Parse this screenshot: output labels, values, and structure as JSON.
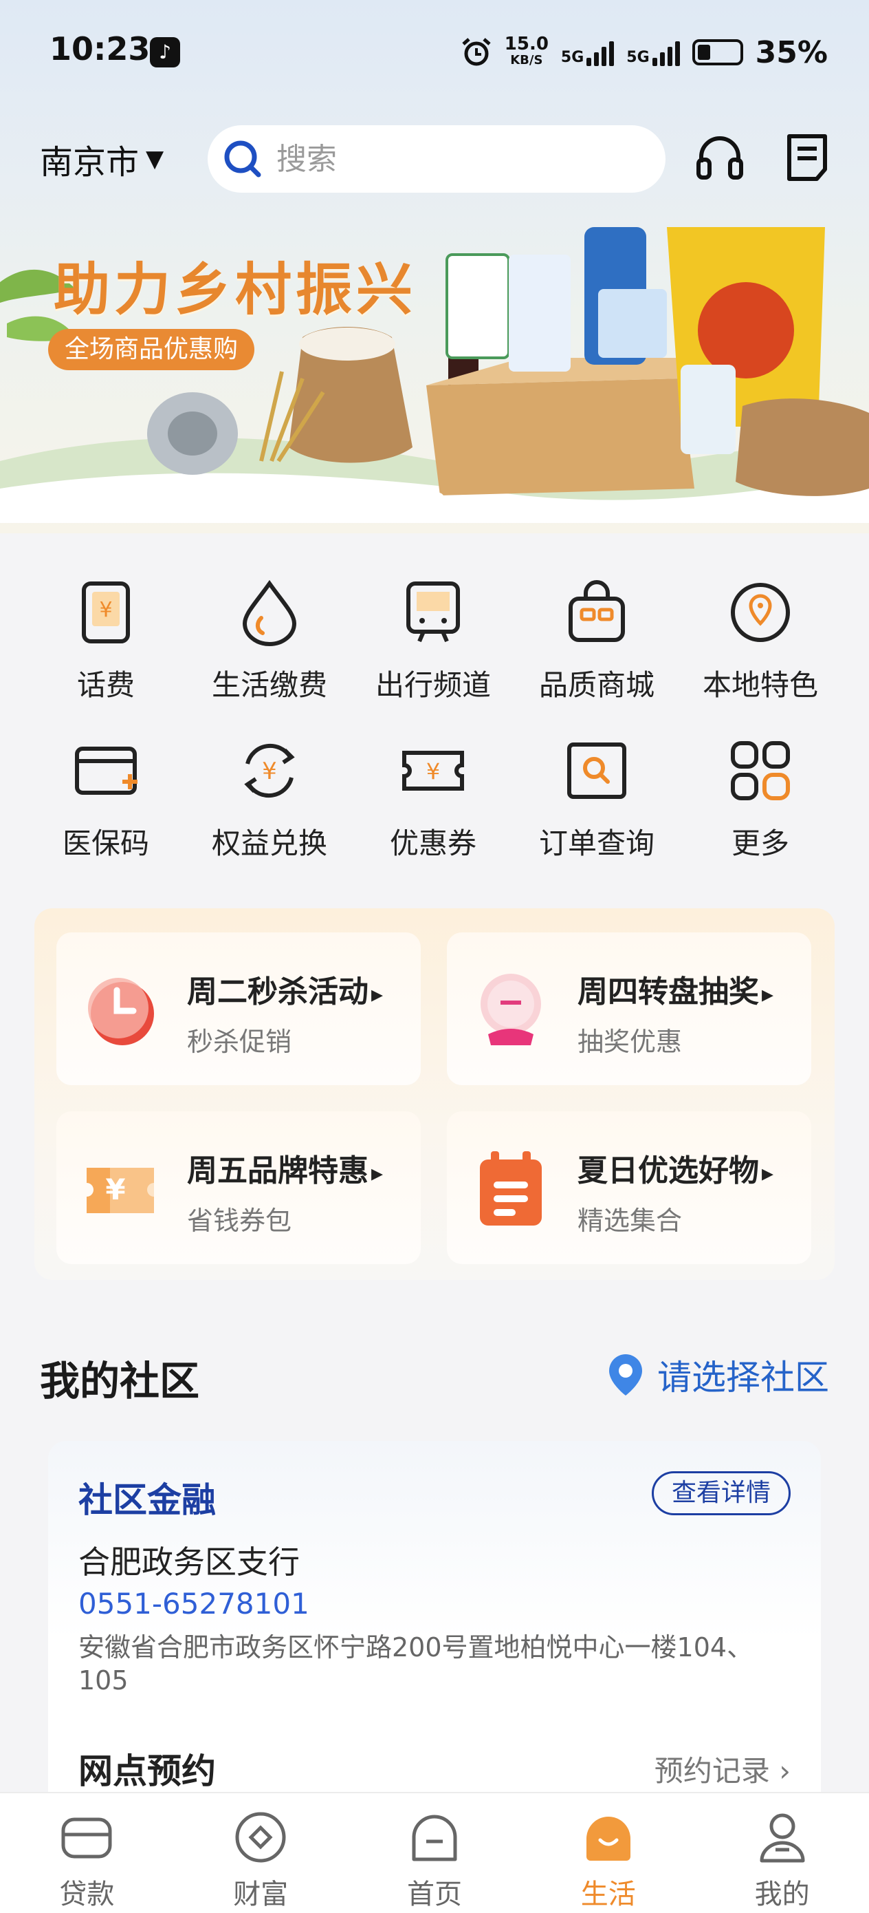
{
  "status_bar": {
    "time": "10:23",
    "net_speed": "15.0",
    "net_unit": "KB/S",
    "sim1": "5G",
    "sim2": "5G",
    "battery": "35%"
  },
  "header": {
    "city": "南京市",
    "search_placeholder": "搜索"
  },
  "banner": {
    "title": "助力乡村振兴",
    "tag": "全场商品优惠购"
  },
  "quick_grid": [
    {
      "label": "话费",
      "icon": "phone-bill-icon"
    },
    {
      "label": "生活缴费",
      "icon": "water-drop-icon"
    },
    {
      "label": "出行频道",
      "icon": "bus-icon"
    },
    {
      "label": "品质商城",
      "icon": "shop-bag-icon"
    },
    {
      "label": "本地特色",
      "icon": "location-pin-icon"
    },
    {
      "label": "医保码",
      "icon": "medical-card-icon"
    },
    {
      "label": "权益兑换",
      "icon": "exchange-icon"
    },
    {
      "label": "优惠券",
      "icon": "coupon-icon"
    },
    {
      "label": "订单查询",
      "icon": "order-search-icon"
    },
    {
      "label": "更多",
      "icon": "more-grid-icon"
    }
  ],
  "promos": [
    {
      "title": "周二秒杀活动",
      "subtitle": "秒杀促销"
    },
    {
      "title": "周四转盘抽奖",
      "subtitle": "抽奖优惠"
    },
    {
      "title": "周五品牌特惠",
      "subtitle": "省钱券包"
    },
    {
      "title": "夏日优选好物",
      "subtitle": "精选集合"
    }
  ],
  "community": {
    "section_title": "我的社区",
    "pick_label": "请选择社区",
    "card_title": "社区金融",
    "detail_button": "查看详情",
    "branch": "合肥政务区支行",
    "phone": "0551-65278101",
    "address": "安徽省合肥市政务区怀宁路200号置地柏悦中心一楼104、105",
    "booking": "网点预约",
    "booking_record": "预约记录 ›"
  },
  "nav": [
    {
      "label": "贷款",
      "icon": "loan-icon"
    },
    {
      "label": "财富",
      "icon": "wealth-icon"
    },
    {
      "label": "首页",
      "icon": "home-icon"
    },
    {
      "label": "生活",
      "icon": "life-icon",
      "active": true
    },
    {
      "label": "我的",
      "icon": "profile-icon"
    }
  ],
  "colors": {
    "accent": "#ef8a2a",
    "brand_blue": "#1d3fa3",
    "link_blue": "#2f5fd6"
  }
}
